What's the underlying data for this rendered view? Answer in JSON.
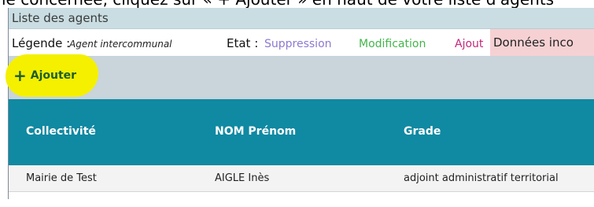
{
  "page_top_text": "le concernée, cliquez sur « + Ajouter » en haut de votre liste d'agents",
  "panel": {
    "title": "Liste des agents"
  },
  "legend": {
    "label": "Légende :",
    "intercommunal": "Agent intercommunal",
    "state_label": "Etat :",
    "suppression": "Suppression",
    "modification": "Modification",
    "ajout": "Ajout",
    "donnees_incompletes": "Données inco"
  },
  "toolbar": {
    "add_label": "Ajouter",
    "add_icon": "plus-icon"
  },
  "colors": {
    "header_teal": "#1089a2",
    "suppression": "#8e79cf",
    "modification": "#43b54a",
    "ajout": "#c2277b",
    "incomplete_bg": "#f6d1d3",
    "highlight": "#f4f000"
  },
  "table": {
    "columns": [
      "Collectivité",
      "NOM Prénom",
      "Grade"
    ],
    "rows": [
      [
        "Mairie de Test",
        "AIGLE Inès",
        "adjoint administratif territorial"
      ]
    ]
  }
}
